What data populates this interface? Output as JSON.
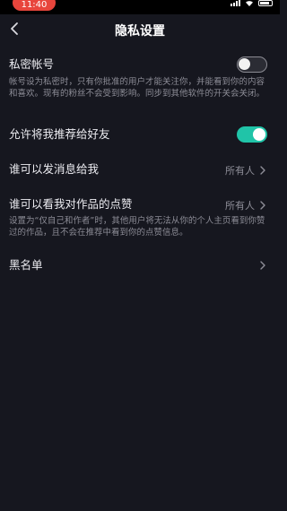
{
  "status_bar": {
    "time": "11:40"
  },
  "nav": {
    "title": "隐私设置"
  },
  "settings": {
    "private_account": {
      "title": "私密帐号",
      "description": "帐号设为私密时，只有你批准的用户才能关注你，并能看到你的内容和喜欢。现有的粉丝不会受到影响。同步到其他软件的开关会关闭。",
      "enabled": false
    },
    "recommend_to_friends": {
      "title": "允许将我推荐给好友",
      "enabled": true
    },
    "who_can_message": {
      "title": "谁可以发消息给我",
      "value": "所有人"
    },
    "who_can_see_likes": {
      "title": "谁可以看我对作品的点赞",
      "value": "所有人",
      "description": "设置为“仅自己和作者”时，其他用户将无法从你的个人主页看到你赞过的作品，且不会在推荐中看到你的点赞信息。"
    },
    "blacklist": {
      "title": "黑名单"
    }
  },
  "colors": {
    "background": "#16171f",
    "toggle_on": "#20c4a8",
    "status_pill": "#e8453c"
  }
}
